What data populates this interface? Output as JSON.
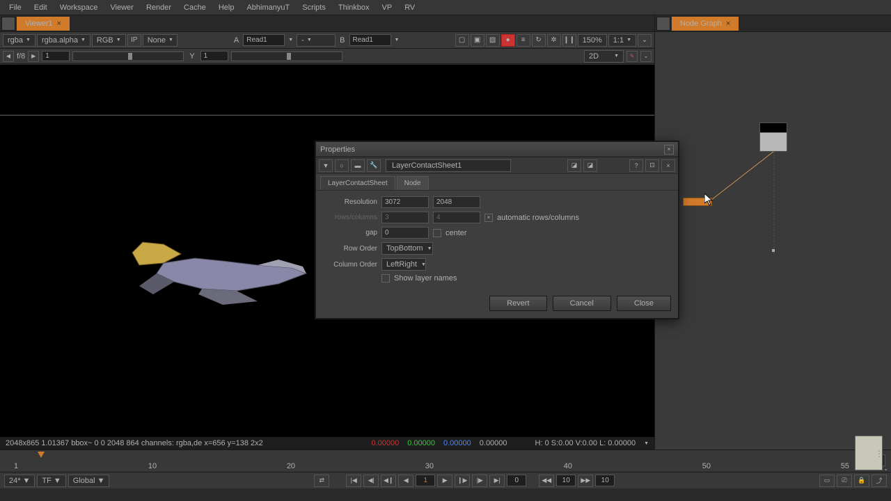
{
  "menu": {
    "items": [
      "File",
      "Edit",
      "Workspace",
      "Viewer",
      "Render",
      "Cache",
      "Help",
      "AbhimanyuT",
      "Scripts",
      "Thinkbox",
      "VP",
      "RV"
    ]
  },
  "tabs": {
    "viewer": "Viewer1",
    "nodegraph": "Node Graph"
  },
  "viewer_toolbar": {
    "layer": "rgba",
    "alpha": "rgba.alpha",
    "channels": "RGB",
    "clip": "None",
    "a_label": "A",
    "a_value": "Read1",
    "dash": "-",
    "b_label": "B",
    "b_value": "Read1",
    "downrez": "150%",
    "ratio": "1:1"
  },
  "framebar": {
    "fstop": "f/8",
    "frame_x": "1",
    "y_label": "Y",
    "frame_y": "1",
    "mode": "2D"
  },
  "infobar": {
    "dims": "2048x865 1.01367  bbox~ 0 0 2048 864 channels: rgba,de  x=656 y=138 2x2",
    "r": "0.00000",
    "g": "0.00000",
    "b": "0.00000",
    "a": "0.00000",
    "hsv": "H:  0 S:0.00 V:0.00  L: 0.00000"
  },
  "timeline": {
    "ticks": [
      "1",
      "10",
      "20",
      "30",
      "40",
      "50",
      "55"
    ],
    "end": "55"
  },
  "transport": {
    "fps": "24*",
    "tf": "TF",
    "scope": "Global",
    "curr_frame": "1",
    "skip_back": "10",
    "skip_fwd": "10",
    "last": "0"
  },
  "dialog": {
    "title": "Properties",
    "node_name": "LayerContactSheet1",
    "tabs": [
      "LayerContactSheet",
      "Node"
    ],
    "labels": {
      "resolution": "Resolution",
      "rowscols": "rows/columns",
      "gap": "gap",
      "roworder": "Row Order",
      "colorder": "Column Order",
      "autorc": "automatic rows/columns",
      "center": "center",
      "shownames": "Show layer names"
    },
    "values": {
      "res_w": "3072",
      "res_h": "2048",
      "rows": "3",
      "cols": "4",
      "gap": "0",
      "roworder": "TopBottom",
      "colorder": "LeftRight"
    },
    "buttons": {
      "revert": "Revert",
      "cancel": "Cancel",
      "close": "Close"
    }
  }
}
